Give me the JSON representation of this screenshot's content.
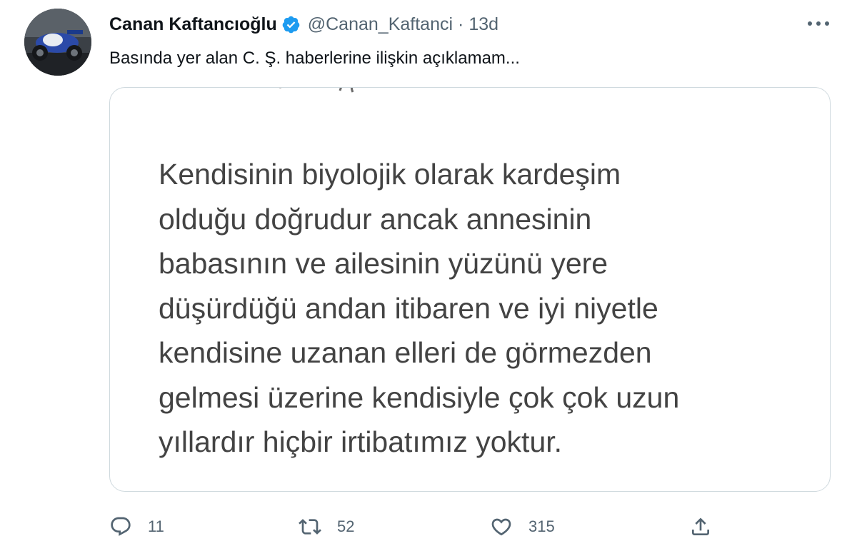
{
  "author": {
    "display_name": "Canan Kaftancıoğlu",
    "handle": "@Canan_Kaftanci",
    "separator": "·",
    "timestamp": "13d",
    "verified": true,
    "avatar_icon": "profile-photo-motorcycle"
  },
  "tweet": {
    "text": "Basında yer alan C. Ş. haberlerine ilişkin açıklamam..."
  },
  "media": {
    "text": "Kendisinin biyolojik olarak kardeşim\nolduğu doğrudur ancak annesinin\nbabasının ve ailesinin yüzünü yere\ndüşürdüğü andan itibaren ve iyi niyetle\nkendisine uzanan elleri de görmezden\ngelmesi üzerine  kendisiyle çok çok  uzun\nyıllardır hiçbir irtibatımız yoktur."
  },
  "actions": {
    "reply_count": "11",
    "retweet_count": "52",
    "like_count": "315"
  },
  "icons": {
    "more": "more-horizontal-icon",
    "reply": "reply-icon",
    "retweet": "retweet-icon",
    "like": "heart-icon",
    "share": "share-icon"
  },
  "colors": {
    "verified": "#1d9bf0",
    "secondary_text": "#536471",
    "primary_text": "#0f1419",
    "border": "#cfd9de",
    "media_text": "#434343"
  }
}
